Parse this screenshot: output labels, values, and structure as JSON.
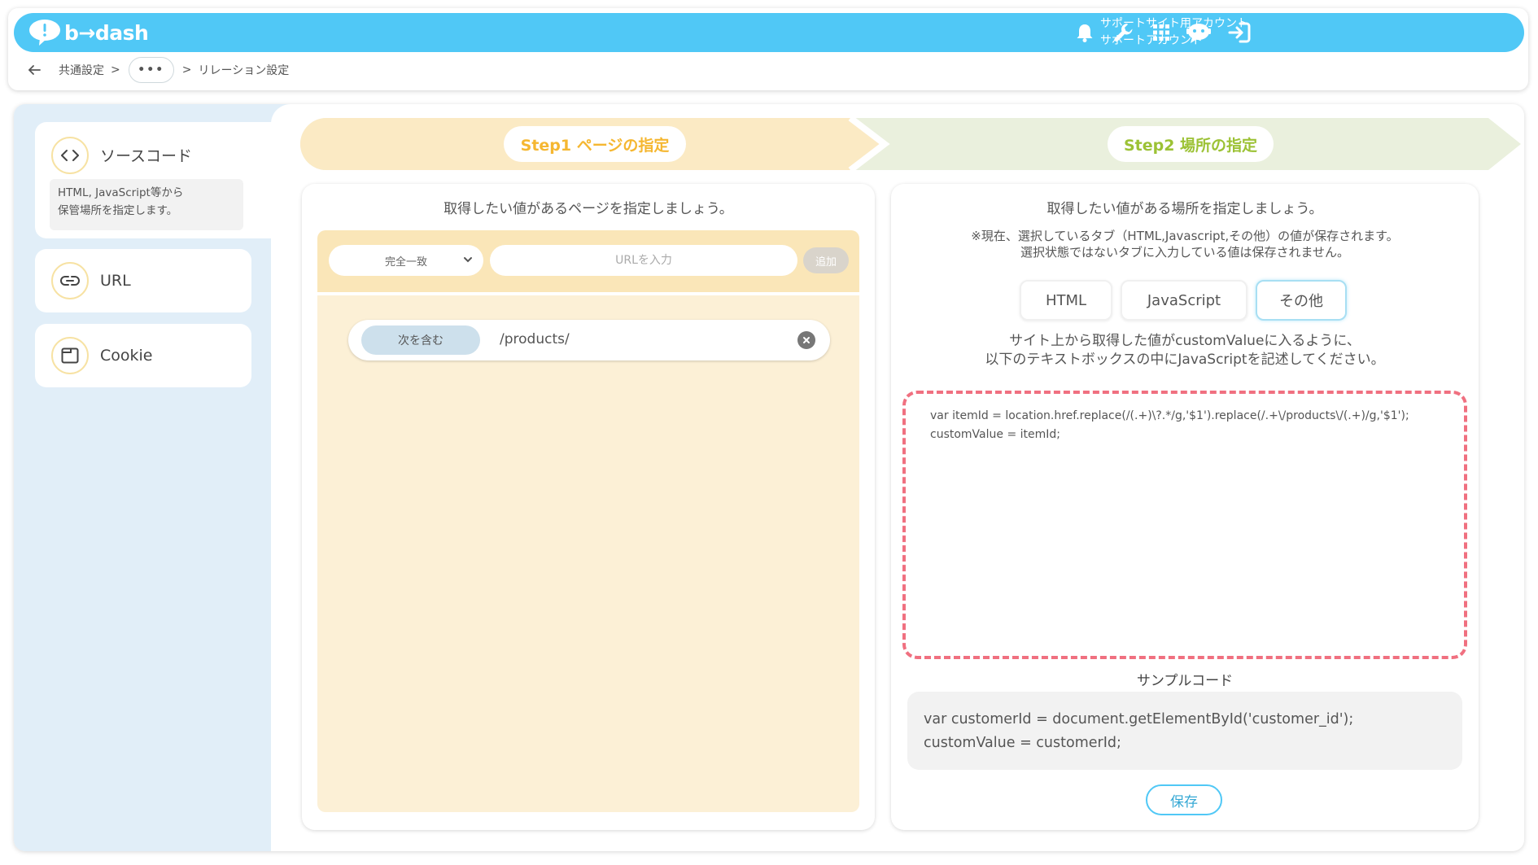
{
  "header": {
    "logo_text": "b→dash",
    "account_line1": "サポートサイト用アカウント",
    "account_line2": "サポートアカウント",
    "icons": [
      "bell-icon",
      "wrench-icon",
      "grid-icon",
      "chatbot-icon",
      "logout-icon"
    ],
    "brand_color": "#50c8f6"
  },
  "breadcrumb": {
    "first": "共通設定",
    "sep": ">",
    "more": "•••",
    "current": "リレーション設定"
  },
  "sidebar": {
    "items": [
      {
        "label": "ソースコード",
        "icon": "code-icon",
        "description": "HTML, JavaScript等から\n保管場所を指定します。",
        "active": true
      },
      {
        "label": "URL",
        "icon": "link-icon",
        "active": false
      },
      {
        "label": "Cookie",
        "icon": "window-icon",
        "active": false
      }
    ]
  },
  "steps": {
    "step1": {
      "label": "Step1 ページの指定",
      "color": "#f5b731",
      "bg": "#fbeac4"
    },
    "step2": {
      "label": "Step2 場所の指定",
      "color": "#9cc235",
      "bg": "#eaf0dd"
    }
  },
  "page_panel": {
    "title": "取得したい値があるページを指定しましょう。",
    "match_select": "完全一致",
    "url_placeholder": "URLを入力",
    "add_button": "追加",
    "rows": [
      {
        "match": "次を含む",
        "value": "/products/"
      }
    ]
  },
  "location_panel": {
    "title": "取得したい値がある場所を指定しましょう。",
    "notice_line1": "※現在、選択しているタブ（HTML,Javascript,その他）の値が保存されます。",
    "notice_line2": "選択状態ではないタブに入力している値は保存されません。",
    "tabs": [
      {
        "label": "HTML",
        "active": false
      },
      {
        "label": "JavaScript",
        "active": false
      },
      {
        "label": "その他",
        "active": true
      }
    ],
    "instruction_line1": "サイト上から取得した値がcustomValueに入るように、",
    "instruction_line2": "以下のテキストボックスの中にJavaScriptを記述してください。",
    "code": "var itemId = location.href.replace(/(.+)\\?.*/g,'$1').replace(/.+\\/products\\/(.+)/g,'$1');\ncustomValue = itemId;",
    "sample_title": "サンプルコード",
    "sample_code": "var customerId = document.getElementById('customer_id');\ncustomValue = customerId;",
    "save_button": "保存",
    "highlight_color": "#f07080"
  }
}
